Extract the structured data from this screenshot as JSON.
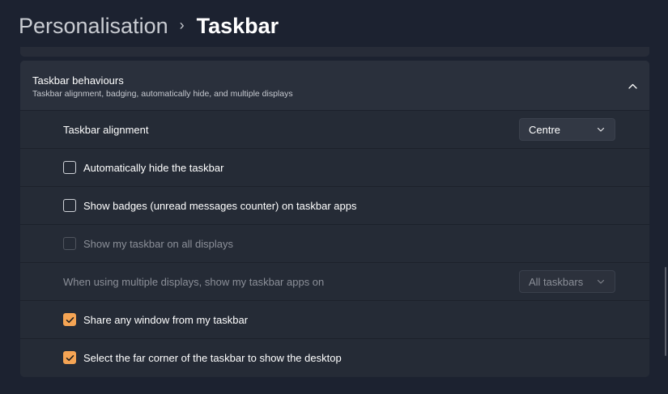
{
  "breadcrumb": {
    "parent": "Personalisation",
    "separator": "›",
    "current": "Taskbar"
  },
  "section": {
    "title": "Taskbar behaviours",
    "subtitle": "Taskbar alignment, badging, automatically hide, and multiple displays",
    "expanded": true
  },
  "settings": {
    "alignment": {
      "label": "Taskbar alignment",
      "value": "Centre"
    },
    "auto_hide": {
      "label": "Automatically hide the taskbar",
      "checked": false
    },
    "badges": {
      "label": "Show badges (unread messages counter) on taskbar apps",
      "checked": false
    },
    "all_displays": {
      "label": "Show my taskbar on all displays",
      "checked": false,
      "disabled": true
    },
    "multi_display_apps": {
      "label": "When using multiple displays, show my taskbar apps on",
      "value": "All taskbars",
      "disabled": true
    },
    "share_window": {
      "label": "Share any window from my taskbar",
      "checked": true
    },
    "far_corner": {
      "label": "Select the far corner of the taskbar to show the desktop",
      "checked": true
    }
  },
  "colors": {
    "accent": "#f5a454",
    "background": "#1c2230",
    "card": "#252b36"
  },
  "icons": {
    "collapse": "chevron-up-icon",
    "dropdown": "chevron-down-icon",
    "check": "checkmark-icon"
  }
}
